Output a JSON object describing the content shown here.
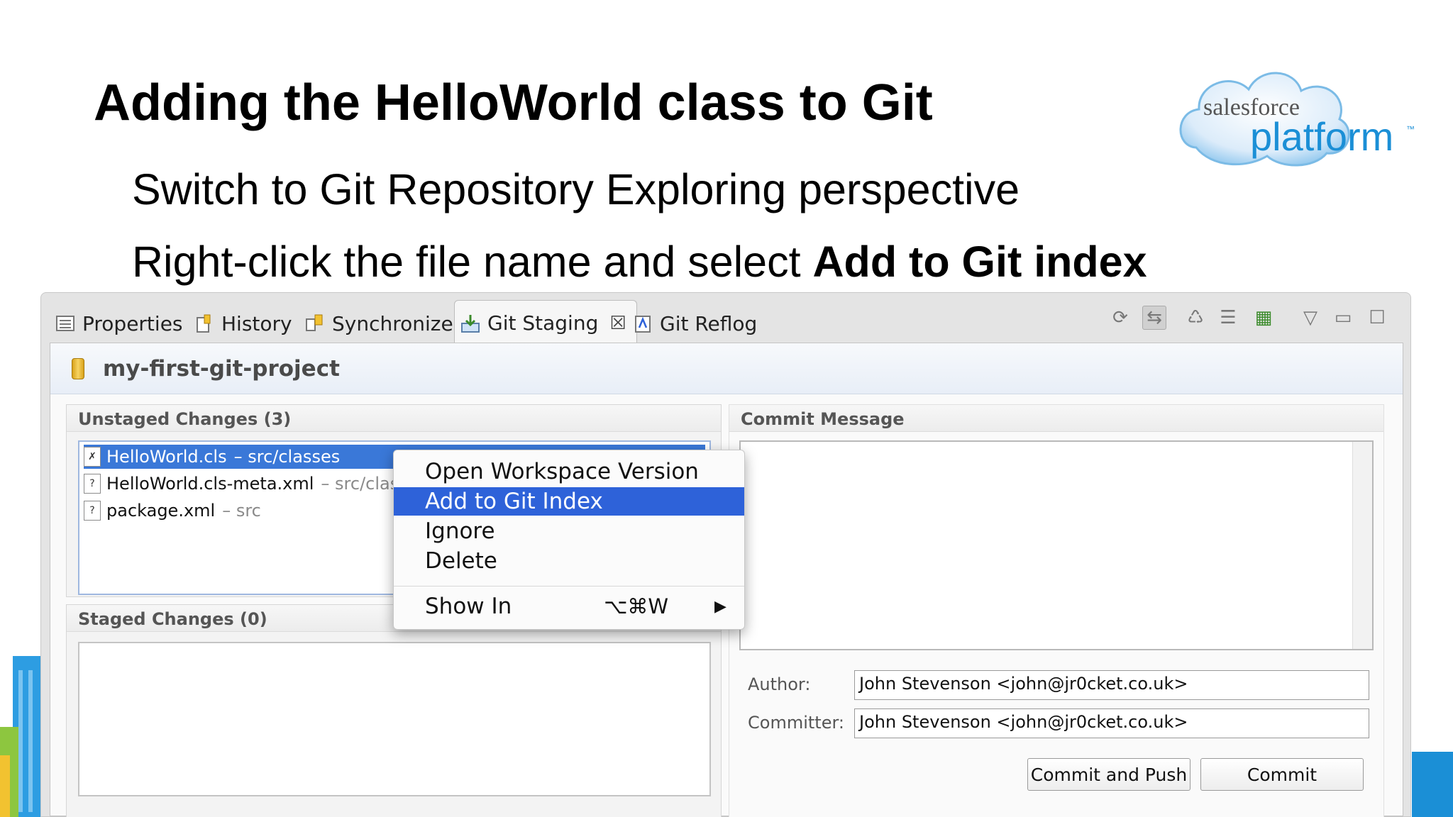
{
  "slide": {
    "title": "Adding the HelloWorld class to Git",
    "bullet_1": "Switch to Git Repository Exploring perspective",
    "bullet_2_prefix": "Right-click the file name and select ",
    "bullet_2_bold": "Add to Git index"
  },
  "logo": {
    "brand": "salesforce",
    "product": "platform",
    "tm": "™"
  },
  "tabs": [
    {
      "label": "Properties",
      "icon": "properties-icon"
    },
    {
      "label": "History",
      "icon": "history-icon"
    },
    {
      "label": "Synchronize",
      "icon": "synchronize-icon"
    },
    {
      "label": "Git Staging",
      "icon": "git-staging-icon",
      "active": true
    },
    {
      "label": "Git Reflog",
      "icon": "git-reflog-icon"
    }
  ],
  "project": {
    "name": "my-first-git-project"
  },
  "unstaged": {
    "header": "Unstaged Changes (3)",
    "items": [
      {
        "name": "HelloWorld.cls",
        "path": "– src/classes"
      },
      {
        "name": "HelloWorld.cls-meta.xml",
        "path": "– src/classes"
      },
      {
        "name": "package.xml",
        "path": "– src"
      }
    ]
  },
  "staged": {
    "header": "Staged Changes (0)"
  },
  "commit": {
    "header": "Commit Message",
    "author_label": "Author:",
    "author_value": "John Stevenson <john@jr0cket.co.uk>",
    "committer_label": "Committer:",
    "committer_value": "John Stevenson <john@jr0cket.co.uk>",
    "commit_push_label": "Commit and Push",
    "commit_label": "Commit"
  },
  "context_menu": {
    "items": [
      "Open Workspace Version",
      "Add to Git Index",
      "Ignore",
      "Delete"
    ],
    "highlighted": "Add to Git Index",
    "show_in": "Show In",
    "show_in_shortcut": "⌥⌘W"
  },
  "colors": {
    "selection": "#3a78d8",
    "menu_highlight": "#2e62d9",
    "logo_blue": "#1b8fd6"
  }
}
